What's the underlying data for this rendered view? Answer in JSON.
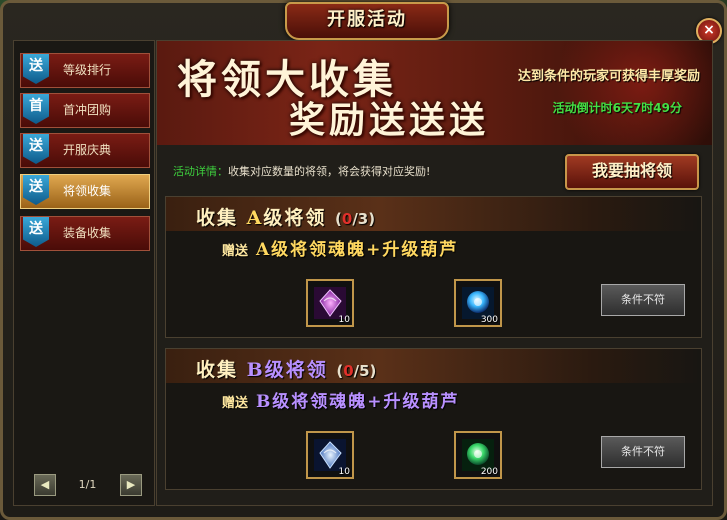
{
  "window": {
    "title": "开服活动",
    "close_label": "×"
  },
  "sidebar": {
    "items": [
      {
        "badge": "送",
        "label": "等级排行",
        "active": false
      },
      {
        "badge": "首",
        "label": "首冲团购",
        "active": false
      },
      {
        "badge": "送",
        "label": "开服庆典",
        "active": false
      },
      {
        "badge": "送",
        "label": "将领收集",
        "active": true
      },
      {
        "badge": "送",
        "label": "装备收集",
        "active": false
      }
    ],
    "pager": {
      "prev": "◀",
      "next": "▶",
      "page": "1/1"
    }
  },
  "banner": {
    "title_line1": "将领大收集",
    "title_line2": "奖励送送送",
    "subtitle": "达到条件的玩家可获得丰厚奖励",
    "countdown": "活动倒计时6天7时49分"
  },
  "details": {
    "key": "活动详情：",
    "text": "收集对应数量的将领，将会获得对应奖励!"
  },
  "draw_button": "我要抽将领",
  "cards": [
    {
      "title_pre": "收集",
      "grade": "A",
      "title_post": "级将领",
      "count_open": "(",
      "count_have": "0",
      "count_rest": "/3)",
      "reward_pre": "赠送",
      "reward": "A级将领魂魄+升级葫芦",
      "items": [
        {
          "icon": "purple-soul-gem-icon",
          "qty": "10"
        },
        {
          "icon": "blue-gourd-orb-icon",
          "qty": "300"
        }
      ],
      "status": "条件不符"
    },
    {
      "title_pre": "收集",
      "grade": "B",
      "title_post": "级将领",
      "count_open": "(",
      "count_have": "0",
      "count_rest": "/5)",
      "reward_pre": "赠送",
      "reward": "B级将领魂魄+升级葫芦",
      "items": [
        {
          "icon": "blue-soul-gem-icon",
          "qty": "10"
        },
        {
          "icon": "green-gourd-orb-icon",
          "qty": "200"
        }
      ],
      "status": "条件不符"
    }
  ],
  "colors": {
    "accent_gold": "#ffd860",
    "grade_b_purple": "#b890ff",
    "countdown_green": "#44e044",
    "warning_red": "#e0302a"
  }
}
